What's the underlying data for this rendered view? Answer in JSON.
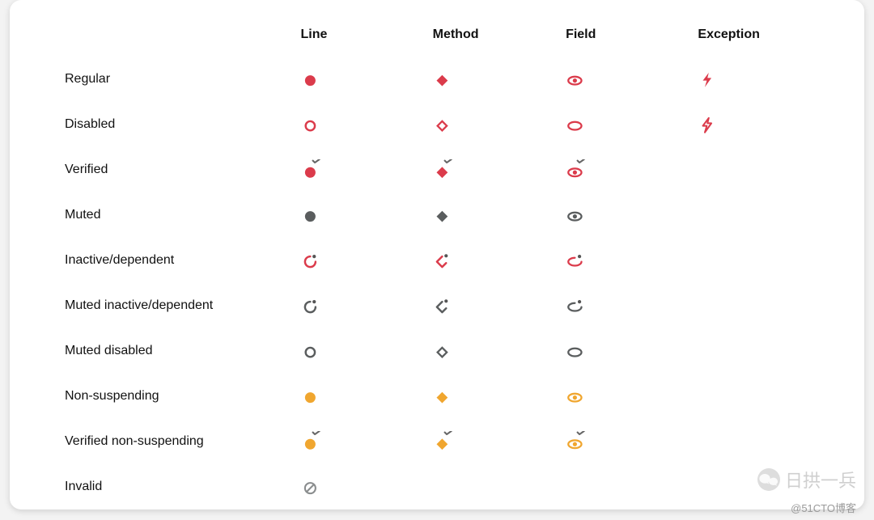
{
  "columns": [
    "",
    "Line",
    "Method",
    "Field",
    "Exception"
  ],
  "colors": {
    "red": "#db3b4b",
    "gray": "#5a5d5e",
    "orange": "#f0a62f",
    "grayLight": "#8a8d8e"
  },
  "rows": [
    {
      "label": "Regular",
      "cells": [
        "circle-solid.red",
        "diamond-solid.red",
        "eye-solid.red",
        "bolt-solid.red"
      ]
    },
    {
      "label": "Disabled",
      "cells": [
        "circle-outline.red",
        "diamond-outline.red",
        "eye-outline.red",
        "bolt-outline.red"
      ]
    },
    {
      "label": "Verified",
      "cells": [
        "circle-solid-check.red",
        "diamond-solid-check.red",
        "eye-solid-check.red",
        ""
      ]
    },
    {
      "label": "Muted",
      "cells": [
        "circle-solid.gray",
        "diamond-solid.gray",
        "eye-solid.gray",
        ""
      ]
    },
    {
      "label": "Inactive/dependent",
      "cells": [
        "circle-depend.red",
        "diamond-depend.red",
        "eye-depend.red",
        ""
      ]
    },
    {
      "label": "Muted inactive/dependent",
      "cells": [
        "circle-depend.gray",
        "diamond-depend.gray",
        "eye-depend.gray",
        ""
      ]
    },
    {
      "label": "Muted disabled",
      "cells": [
        "circle-outline.gray",
        "diamond-outline.gray",
        "eye-outline.gray",
        ""
      ]
    },
    {
      "label": "Non-suspending",
      "cells": [
        "circle-solid.orange",
        "diamond-solid.orange",
        "eye-solid.orange",
        ""
      ]
    },
    {
      "label": "Verified non-suspending",
      "cells": [
        "circle-solid-check.orange",
        "diamond-solid-check.orange",
        "eye-solid-check.orange",
        ""
      ]
    },
    {
      "label": "Invalid",
      "cells": [
        "invalid.grayLight",
        "",
        "",
        ""
      ]
    }
  ],
  "watermark": "日拱一兵",
  "attribution": "@51CTO博客"
}
